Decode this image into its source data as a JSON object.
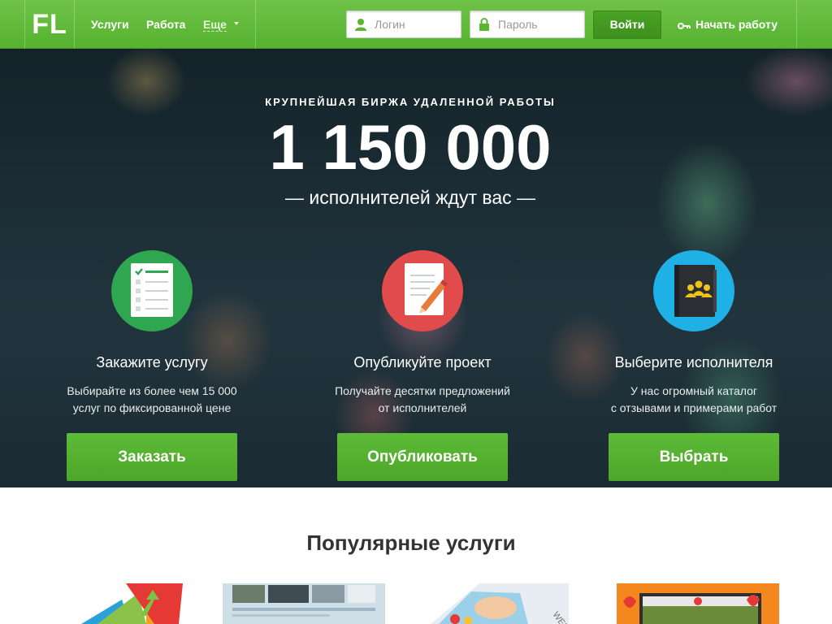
{
  "header": {
    "logo": "FL",
    "nav": [
      "Услуги",
      "Работа",
      "Еще"
    ],
    "login_placeholder": "Логин",
    "password_placeholder": "Пароль",
    "login_button": "Войти",
    "start_link": "Начать работу",
    "accent": "#5cb531"
  },
  "hero": {
    "subtitle": "КРУПНЕЙШАЯ БИРЖА УДАЛЕННОЙ РАБОТЫ",
    "number": "1 150 000",
    "tagline": "— исполнителей ждут вас —",
    "columns": [
      {
        "icon": "checklist-icon",
        "color": "#2fa650",
        "title": "Закажите услугу",
        "desc1": "Выбирайте из более чем 15 000",
        "desc2": "услуг по фиксированной цене",
        "button": "Заказать"
      },
      {
        "icon": "document-pencil-icon",
        "color": "#e24b4b",
        "title": "Опубликуйте проект",
        "desc1": "Получайте десятки предложений",
        "desc2": "от исполнителей",
        "button": "Опубликовать"
      },
      {
        "icon": "catalog-book-icon",
        "color": "#1fb0e6",
        "title": "Выберите исполнителя",
        "desc1": "У нас огромный каталог",
        "desc2": "с отзывами и примерами работ",
        "button": "Выбрать"
      }
    ]
  },
  "popular": {
    "title": "Популярные услуги"
  }
}
